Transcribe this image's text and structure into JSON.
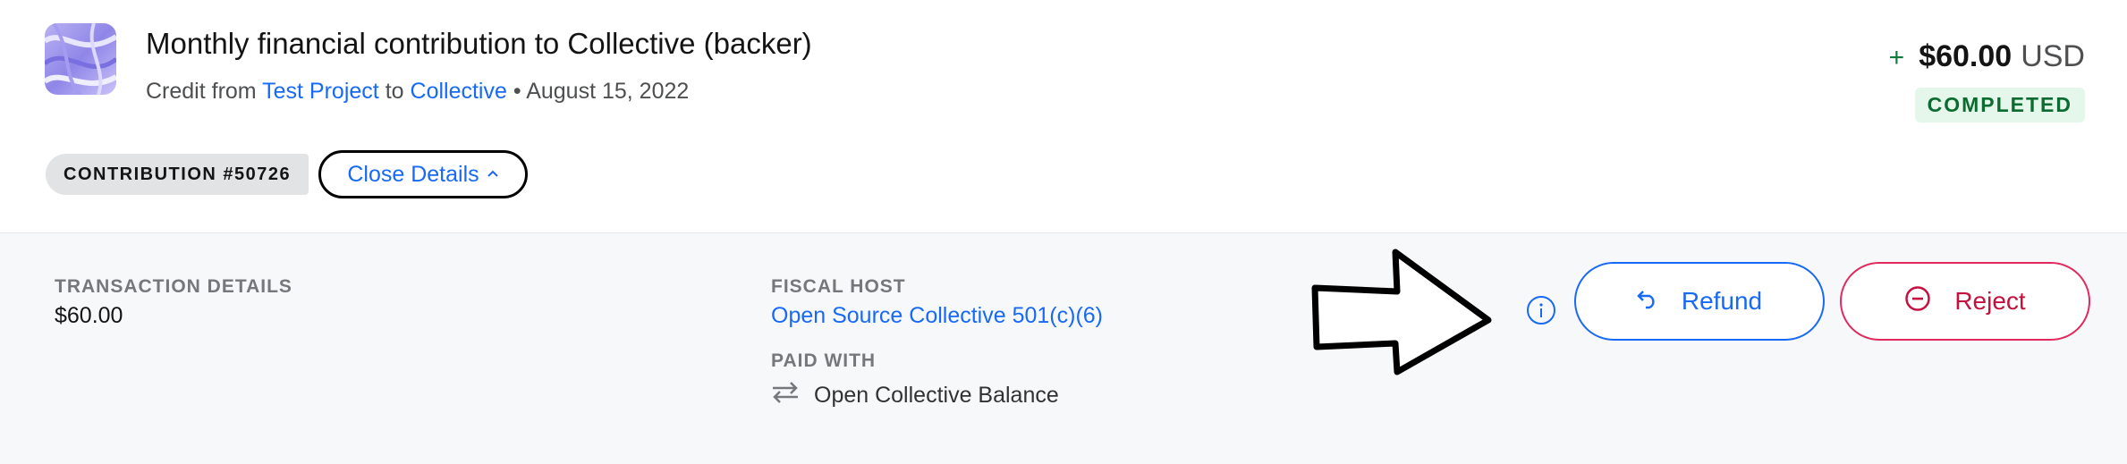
{
  "transaction": {
    "title": "Monthly financial contribution to Collective (backer)",
    "credit_from_label": "Credit from",
    "from_name": "Test Project",
    "to_label": "to",
    "to_name": "Collective",
    "separator": "•",
    "date": "August 15, 2022",
    "amount_sign": "+",
    "amount_value": "$60.00",
    "amount_currency": "USD",
    "status": "COMPLETED",
    "contribution_tag": "CONTRIBUTION #50726",
    "close_details_label": "Close Details"
  },
  "details": {
    "transaction_details_label": "TRANSACTION DETAILS",
    "transaction_details_value": "$60.00",
    "fiscal_host_label": "FISCAL HOST",
    "fiscal_host_value": "Open Source Collective 501(c)(6)",
    "paid_with_label": "PAID WITH",
    "paid_with_value": "Open Collective Balance"
  },
  "actions": {
    "refund_label": "Refund",
    "reject_label": "Reject"
  },
  "colors": {
    "link": "#1869f5",
    "success": "#0b6b30",
    "danger": "#c4113f"
  }
}
